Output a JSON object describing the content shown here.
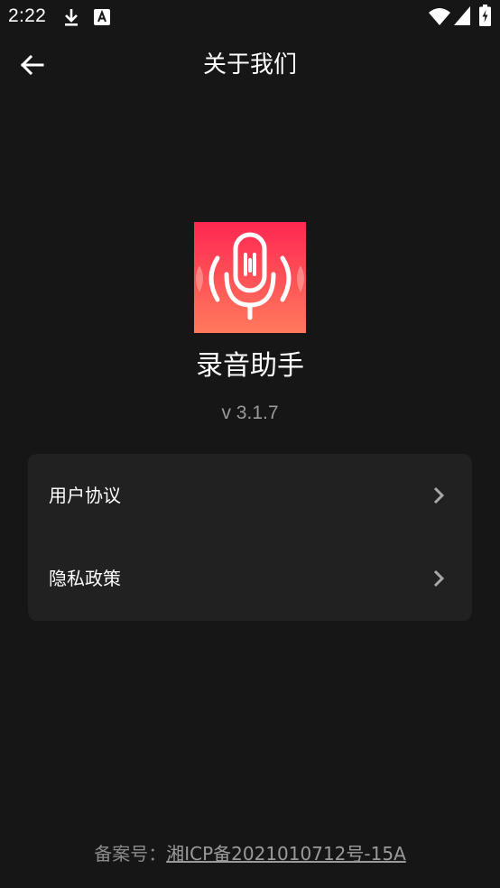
{
  "status_bar": {
    "time": "2:22",
    "icons": [
      "download-icon",
      "keyboard-a-icon",
      "wifi-icon",
      "signal-icon",
      "battery-charging-icon"
    ]
  },
  "header": {
    "title": "关于我们",
    "back_icon": "arrow-left-icon"
  },
  "app": {
    "name": "录音助手",
    "version": "v 3.1.7",
    "logo_icon": "microphone-icon",
    "logo_colors": [
      "#ff2d52",
      "#ff7a5c"
    ]
  },
  "menu": {
    "items": [
      {
        "label": "用户协议",
        "icon": "chevron-right-icon"
      },
      {
        "label": "隐私政策",
        "icon": "chevron-right-icon"
      }
    ]
  },
  "footer": {
    "label": "备案号：",
    "record_number": "湘ICP备2021010712号-15A"
  },
  "colors": {
    "background": "#161616",
    "card": "#212121",
    "secondary_text": "#9a9a9a"
  }
}
